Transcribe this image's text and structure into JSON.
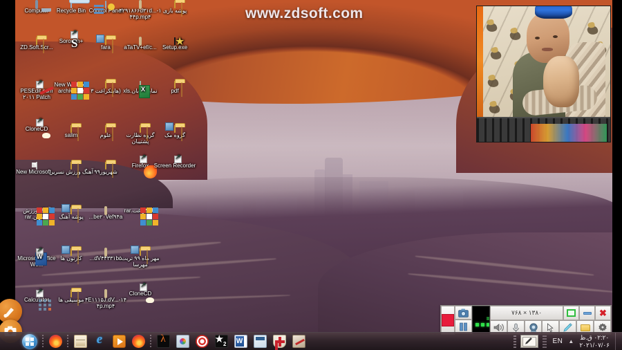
{
  "watermark": {
    "text": "www.zdsoft.com"
  },
  "desktop": {
    "icons": [
      {
        "label": "Computer",
        "type": "computer"
      },
      {
        "label": "Recycle Bin",
        "type": "recycle-bin"
      },
      {
        "label": "Control Panel",
        "type": "control-panel"
      },
      {
        "label": "۴۲۹۱۸۶۶d۳۱d...-۱۴۴p.mp۴",
        "type": "video"
      },
      {
        "label": "پوشه بازی",
        "type": "folder"
      },
      {
        "label": "ZD.Soft.Scr...",
        "type": "app-zdsoft"
      },
      {
        "label": "Soroush+",
        "type": "app-soroush"
      },
      {
        "label": "fara",
        "type": "folder-open"
      },
      {
        "label": "aTaTV+ef/c...",
        "type": "video"
      },
      {
        "label": "Setup.exe",
        "type": "setup"
      },
      {
        "label": "PESEdit.com ۲۰۱۱ Patch",
        "type": "pesedit"
      },
      {
        "label": "New WinRAR archive.rar",
        "type": "rar"
      },
      {
        "label": "(هایتکراغت ۳",
        "type": "folder"
      },
      {
        "label": "نماینده ابان.xls",
        "type": "xls"
      },
      {
        "label": "pdf",
        "type": "folder"
      },
      {
        "label": "CloneCD",
        "type": "app-clonecd"
      },
      {
        "label": "salim",
        "type": "folder"
      },
      {
        "label": "علوم",
        "type": "folder"
      },
      {
        "label": "گروه نظارت پشتیبان",
        "type": "folder"
      },
      {
        "label": "گروه مک",
        "type": "folder-open"
      },
      {
        "label": "New Microsoft ...",
        "type": "doc"
      },
      {
        "label": "آهنگ ورزش نسرین",
        "type": "folder"
      },
      {
        "label": "شهریور۹۹",
        "type": "folder"
      },
      {
        "label": "Firefox",
        "type": "app-firefox"
      },
      {
        "label": "Screen Recorder",
        "type": "app-recorder"
      },
      {
        "label": "آهنگ ورزش نسرین.rar",
        "type": "rar"
      },
      {
        "label": "پوشه آهنگ",
        "type": "folder-open"
      },
      {
        "label": "be۲۰Vef۹۴a...",
        "type": "video"
      },
      {
        "label": "هایتکراغت.rar",
        "type": "rar"
      },
      {
        "label": "Microsoft Office Wo...",
        "type": "word"
      },
      {
        "label": "کارتون ها",
        "type": "folder-open"
      },
      {
        "label": "dV۴۴۳۳۱b۵...",
        "type": "video"
      },
      {
        "label": "مهر ماه ۹۹ تربت مهرسا",
        "type": "folder-open"
      },
      {
        "label": "Calculator",
        "type": "calculator"
      },
      {
        "label": "موسیقی ها",
        "type": "folder"
      },
      {
        "label": "۴E۱۱۱۵J.dV...-۱۴۴p.mp۴",
        "type": "video"
      },
      {
        "label": "CloneCD",
        "type": "app-clonecd"
      }
    ]
  },
  "floating_tools": [
    {
      "name": "pen-tool",
      "label": "Pen"
    },
    {
      "name": "camera-tool",
      "label": "Capture"
    }
  ],
  "recorder_toolbar": {
    "stop_label": "Stop",
    "snapshot_label": "Snapshot",
    "pause_label": "Pause",
    "resolution": "۱۳۸۰ × ۷۶۸",
    "vu_meter_label": "Audio level",
    "buttons": [
      {
        "name": "region-button",
        "label": "Region"
      },
      {
        "name": "minimize-button",
        "label": "Minimize"
      },
      {
        "name": "close-button",
        "label": "Close"
      },
      {
        "name": "speaker-button",
        "label": "Speakers"
      },
      {
        "name": "microphone-button",
        "label": "Microphone"
      },
      {
        "name": "webcam-button",
        "label": "Webcam"
      },
      {
        "name": "cursor-button",
        "label": "Cursor"
      },
      {
        "name": "pencil-button",
        "label": "Draw"
      },
      {
        "name": "folder-button",
        "label": "Output folder"
      },
      {
        "name": "settings-button",
        "label": "Settings"
      }
    ]
  },
  "taskbar": {
    "start_label": "Start",
    "items": [
      {
        "name": "taskbar-firefox",
        "label": "Firefox"
      },
      {
        "name": "taskbar-explorer",
        "label": "Windows Explorer"
      },
      {
        "name": "taskbar-ie",
        "label": "Internet Explorer"
      },
      {
        "name": "taskbar-wmp",
        "label": "Windows Media Player"
      },
      {
        "name": "taskbar-firefox-2",
        "label": "Firefox"
      },
      {
        "name": "taskbar-halflife",
        "label": "Half-Life"
      },
      {
        "name": "taskbar-paint",
        "label": "Paint"
      },
      {
        "name": "taskbar-target",
        "label": "Target"
      },
      {
        "name": "taskbar-star2",
        "label": "Star 2"
      },
      {
        "name": "taskbar-word",
        "label": "Microsoft Word"
      },
      {
        "name": "taskbar-calculator",
        "label": "Calculator"
      },
      {
        "name": "taskbar-shield",
        "label": "Shield"
      },
      {
        "name": "taskbar-ps",
        "label": "Photo Editor"
      }
    ],
    "tray": {
      "pen_label": "Tablet input",
      "language": "EN",
      "chevron": "▲",
      "time": "۰۲:۲۰ ق.ظ",
      "date": "۲۰۲۱/۰۷/۰۶"
    }
  },
  "webcam": {
    "label": "Webcam overlay"
  },
  "colors": {
    "record_red": "#e81c3c",
    "accent_orange": "#d9781f",
    "vu_green": "#2fe04a",
    "close_red": "#d41f27"
  }
}
